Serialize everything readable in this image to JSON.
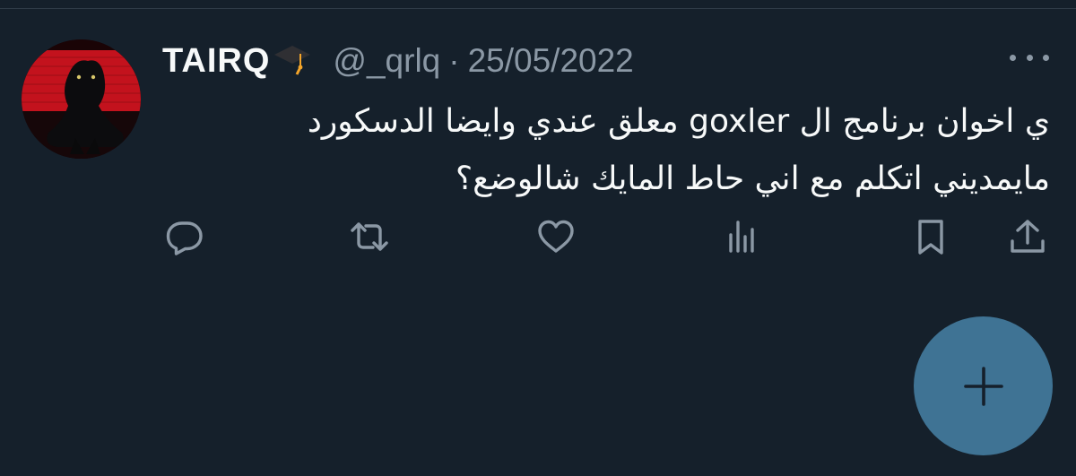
{
  "tweet": {
    "display_name": "TAIRQ",
    "name_emoji": "graduation-cap-icon",
    "handle": "@_qrlq",
    "separator": "·",
    "date": "25/05/2022",
    "text_lines": [
      "ي اخوان برنامج ال goxler معلق عندي وايضا الدسكورد",
      "مايمديني اتكلم مع اني حاط المايك شالوضع؟"
    ]
  },
  "actions": {
    "reply": "reply-icon",
    "retweet": "retweet-icon",
    "like": "heart-icon",
    "views": "analytics-icon",
    "bookmark": "bookmark-icon",
    "share": "share-icon"
  },
  "fab": {
    "icon": "plus-icon"
  },
  "colors": {
    "background": "#15202b",
    "text_primary": "#f7f9f9",
    "text_secondary": "#8b98a5",
    "fab": "#3f7394",
    "avatar_red": "#c3121d"
  }
}
